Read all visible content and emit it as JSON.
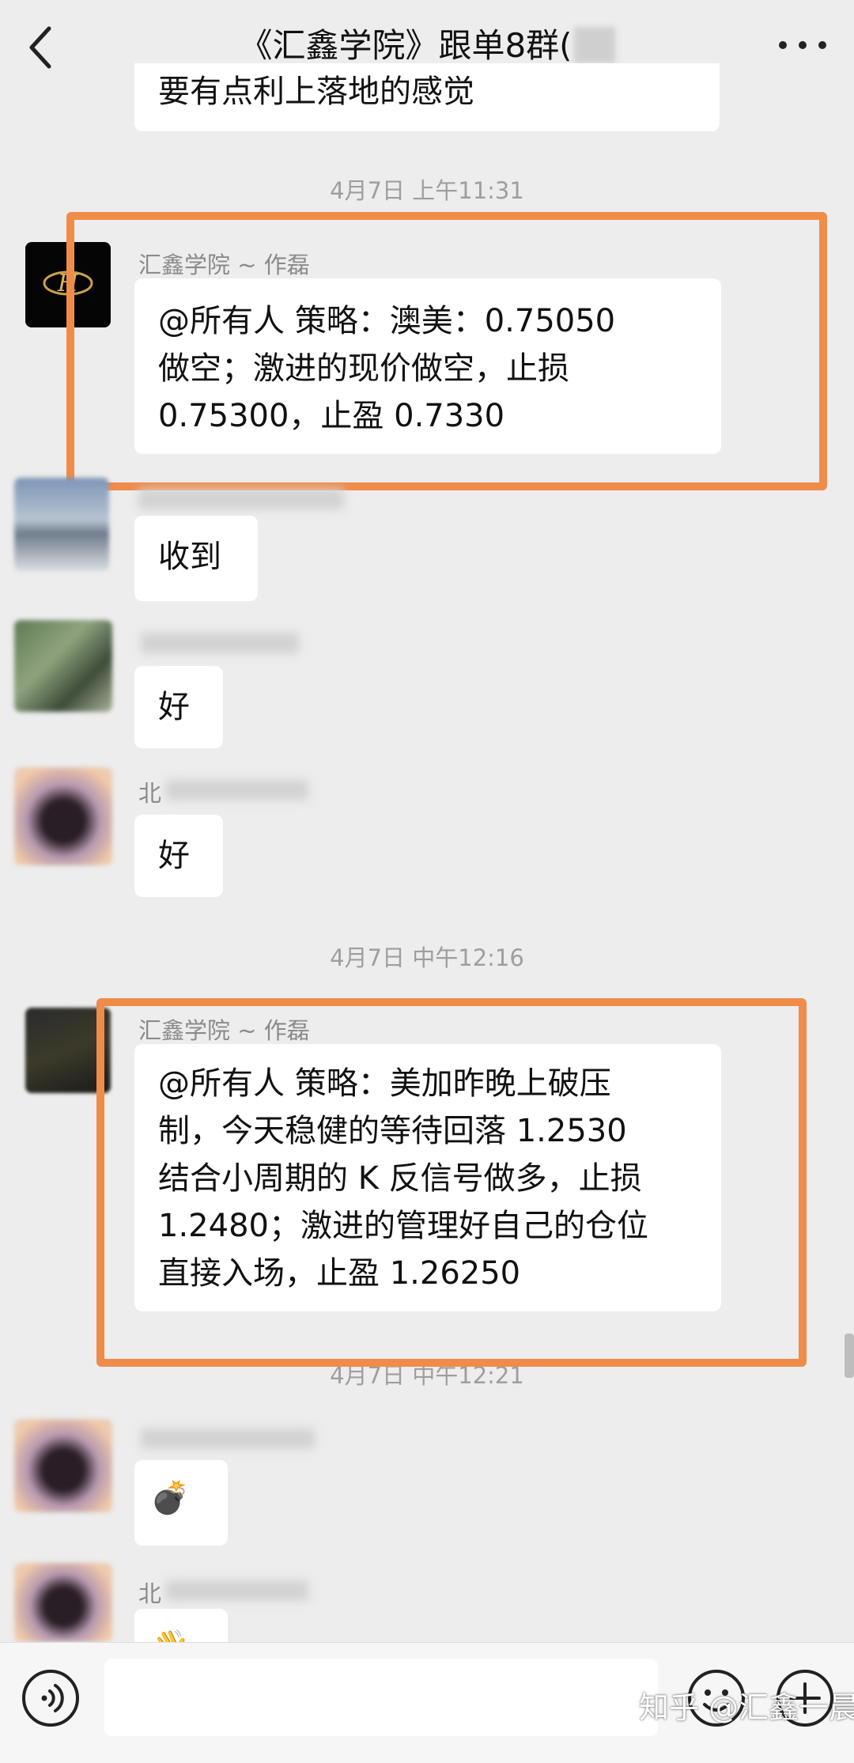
{
  "header": {
    "title": "《汇鑫学院》跟单8群(",
    "back_icon": "chevron-left-icon",
    "more_icon": "more-dots-icon"
  },
  "top_partial_message": "要有点利上落地的感觉",
  "timestamps": [
    "4月7日 上午11:31",
    "4月7日 中午12:16",
    "4月7日 中午12:21"
  ],
  "messages": [
    {
      "sender": "汇鑫学院 ~ 作磊",
      "lines": [
        "@所有人  策略：澳美：0.75050",
        "做空；激进的现价做空，止损",
        "0.75300，止盈 0.7330"
      ]
    },
    {
      "sender": "",
      "lines": [
        "收到"
      ]
    },
    {
      "sender": "",
      "lines": [
        "好"
      ]
    },
    {
      "sender": "北",
      "lines": [
        "好"
      ]
    },
    {
      "sender": "汇鑫学院 ~ 作磊",
      "lines": [
        "@所有人  策略：美加昨晚上破压",
        "制，今天稳健的等待回落 1.2530",
        "结合小周期的 K 反信号做多，止损",
        "1.2480；激进的管理好自己的仓位",
        "直接入场，止盈 1.26250"
      ]
    },
    {
      "sender": "",
      "lines": [
        "💣"
      ]
    },
    {
      "sender": "北",
      "lines": [
        "👋"
      ]
    }
  ],
  "bottom_bar": {
    "voice_icon": "voice-icon",
    "emoji_icon": "emoji-icon",
    "add_icon": "add-icon"
  },
  "watermark": "知乎 @汇鑫一晨曦",
  "colors": {
    "highlight": "#f08c4a",
    "background": "#ededed"
  }
}
